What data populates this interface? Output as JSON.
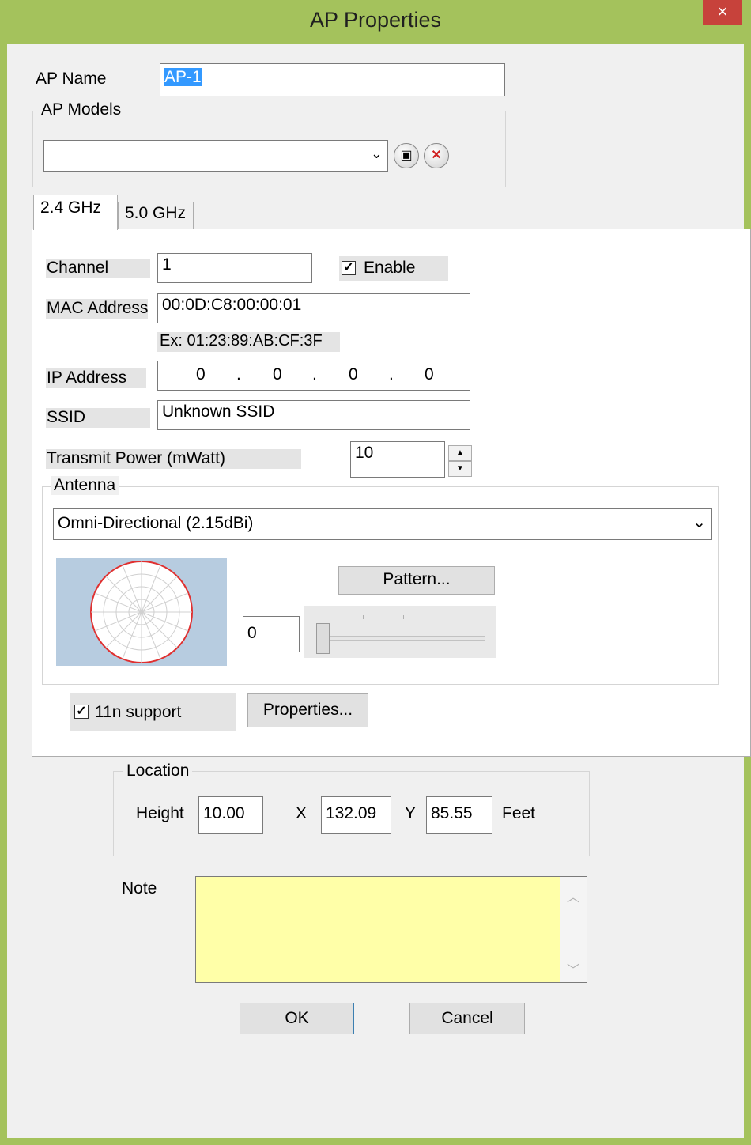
{
  "window": {
    "title": "AP Properties",
    "close_symbol": "×"
  },
  "ap_name": {
    "label": "AP Name",
    "value": "AP-1"
  },
  "ap_models": {
    "group_label": "AP Models",
    "selected": "",
    "save_icon": "save-disk-icon",
    "delete_icon": "delete-x-icon"
  },
  "tabs": [
    {
      "label": "2.4 GHz",
      "active": true
    },
    {
      "label": "5.0 GHz",
      "active": false
    }
  ],
  "channel": {
    "label": "Channel",
    "value": "1"
  },
  "enable": {
    "label": "Enable",
    "checked": true
  },
  "mac": {
    "label": "MAC Address",
    "value": "00:0D:C8:00:00:01",
    "example": "Ex: 01:23:89:AB:CF:3F"
  },
  "ip": {
    "label": "IP Address",
    "octets": [
      "0",
      "0",
      "0",
      "0"
    ]
  },
  "ssid": {
    "label": "SSID",
    "value": "Unknown SSID"
  },
  "power": {
    "label": "Transmit Power (mWatt)",
    "value": "10"
  },
  "antenna": {
    "group_label": "Antenna",
    "selected": "Omni-Directional (2.15dBi)",
    "pattern_button": "Pattern...",
    "angle_value": "0"
  },
  "n_support": {
    "label": "11n support",
    "checked": true,
    "properties_button": "Properties..."
  },
  "location": {
    "group_label": "Location",
    "height_label": "Height",
    "height_value": "10.00",
    "x_label": "X",
    "x_value": "132.09",
    "y_label": "Y",
    "y_value": "85.55",
    "unit": "Feet"
  },
  "note": {
    "label": "Note",
    "value": ""
  },
  "buttons": {
    "ok": "OK",
    "cancel": "Cancel"
  },
  "colors": {
    "title_bar": "#a4c25c",
    "close_button": "#c7423b",
    "note_background": "#ffffa8",
    "selection": "#3399ff",
    "pattern_circle": "#e03030"
  }
}
